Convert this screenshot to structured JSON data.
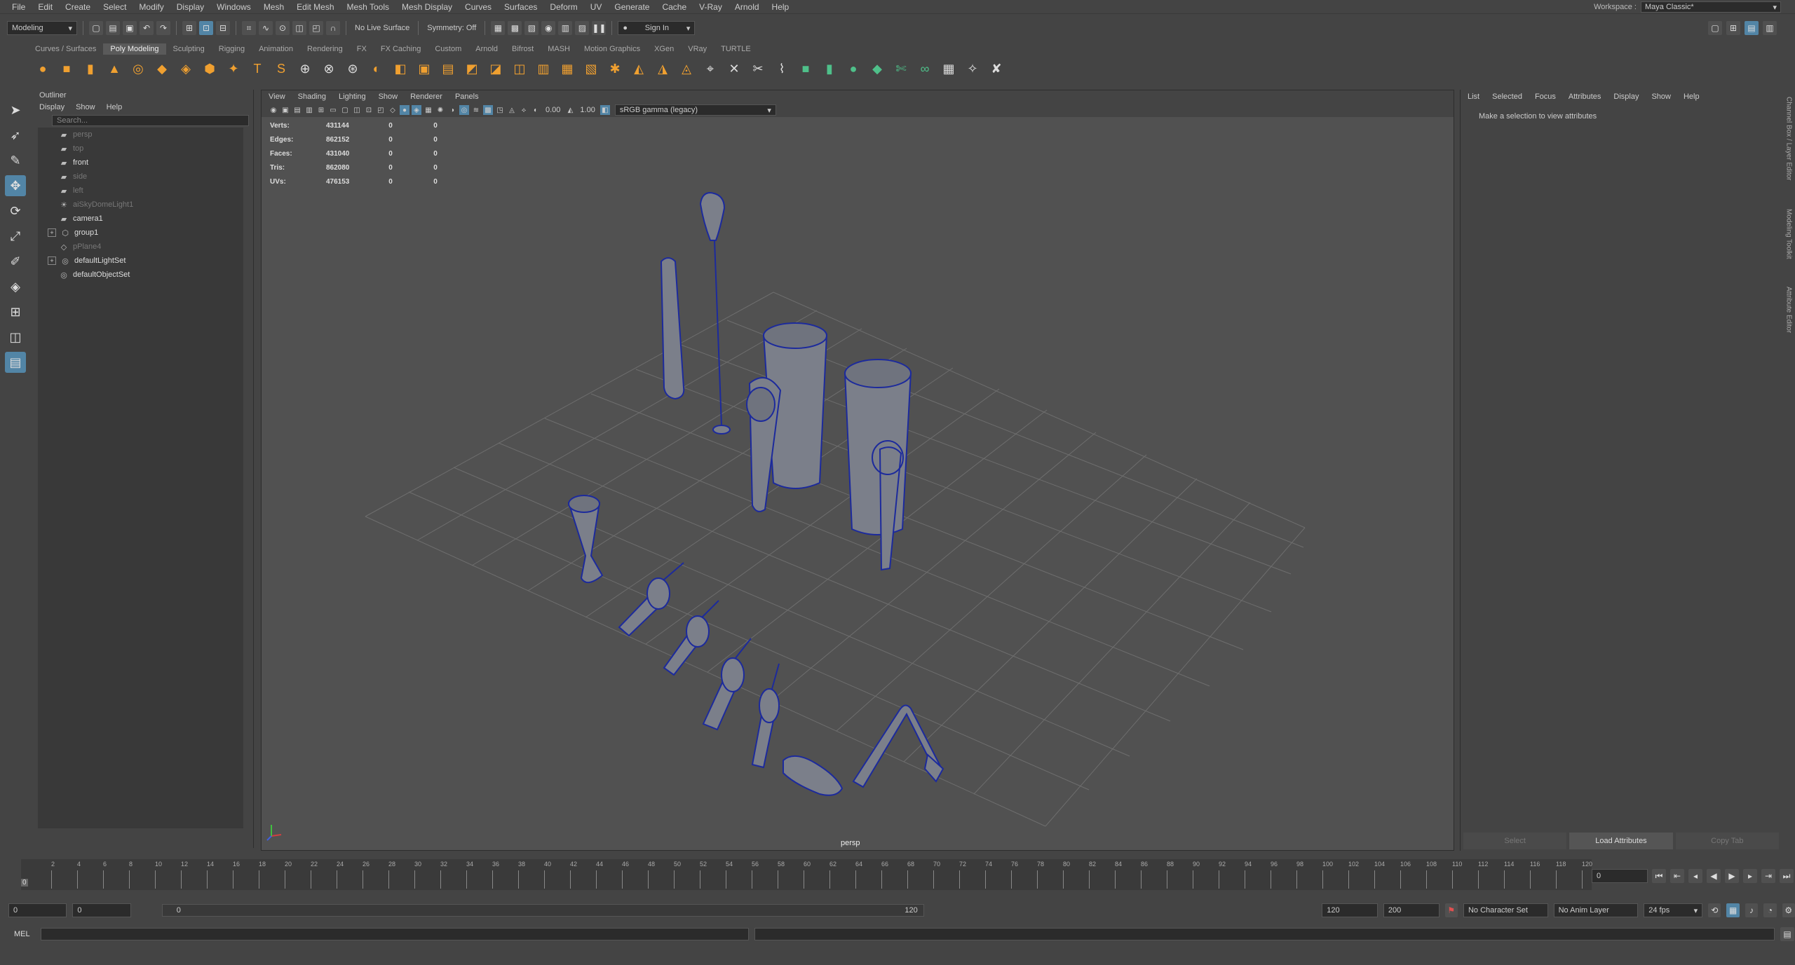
{
  "menubar": [
    "File",
    "Edit",
    "Create",
    "Select",
    "Modify",
    "Display",
    "Windows",
    "Mesh",
    "Edit Mesh",
    "Mesh Tools",
    "Mesh Display",
    "Curves",
    "Surfaces",
    "Deform",
    "UV",
    "Generate",
    "Cache",
    "V-Ray",
    "Arnold",
    "Help"
  ],
  "workspace": {
    "label": "Workspace :",
    "value": "Maya Classic*"
  },
  "statusline": {
    "mode": "Modeling",
    "live_surface": "No Live Surface",
    "symmetry": "Symmetry: Off",
    "sign_in": "Sign In"
  },
  "shelf_tabs": [
    "Curves / Surfaces",
    "Poly Modeling",
    "Sculpting",
    "Rigging",
    "Animation",
    "Rendering",
    "FX",
    "FX Caching",
    "Custom",
    "Arnold",
    "Bifrost",
    "MASH",
    "Motion Graphics",
    "XGen",
    "VRay",
    "TURTLE"
  ],
  "shelf_active": "Poly Modeling",
  "outliner": {
    "title": "Outliner",
    "menus": [
      "Display",
      "Show",
      "Help"
    ],
    "search_placeholder": "Search...",
    "items": [
      {
        "label": "persp",
        "dim": true,
        "icon": "camera-icon"
      },
      {
        "label": "top",
        "dim": true,
        "icon": "camera-icon"
      },
      {
        "label": "front",
        "dim": false,
        "icon": "camera-icon"
      },
      {
        "label": "side",
        "dim": true,
        "icon": "camera-icon"
      },
      {
        "label": "left",
        "dim": true,
        "icon": "camera-icon"
      },
      {
        "label": "aiSkyDomeLight1",
        "dim": true,
        "icon": "light-icon"
      },
      {
        "label": "camera1",
        "dim": false,
        "icon": "camera-icon"
      },
      {
        "label": "group1",
        "dim": false,
        "icon": "group-icon",
        "expand": true
      },
      {
        "label": "pPlane4",
        "dim": true,
        "icon": "mesh-icon"
      },
      {
        "label": "defaultLightSet",
        "dim": false,
        "icon": "set-icon",
        "expand": true
      },
      {
        "label": "defaultObjectSet",
        "dim": false,
        "icon": "set-icon"
      }
    ]
  },
  "viewport": {
    "menus": [
      "View",
      "Shading",
      "Lighting",
      "Show",
      "Renderer",
      "Panels"
    ],
    "exposure": "0.00",
    "gamma": "1.00",
    "colorspace": "sRGB gamma (legacy)",
    "camera": "persp",
    "hud": [
      {
        "key": "Verts:",
        "v": "431144",
        "a": "0",
        "b": "0"
      },
      {
        "key": "Edges:",
        "v": "862152",
        "a": "0",
        "b": "0"
      },
      {
        "key": "Faces:",
        "v": "431040",
        "a": "0",
        "b": "0"
      },
      {
        "key": "Tris:",
        "v": "862080",
        "a": "0",
        "b": "0"
      },
      {
        "key": "UVs:",
        "v": "476153",
        "a": "0",
        "b": "0"
      }
    ]
  },
  "attribute_editor": {
    "menus": [
      "List",
      "Selected",
      "Focus",
      "Attributes",
      "Display",
      "Show",
      "Help"
    ],
    "message": "Make a selection to view attributes",
    "buttons": [
      "Select",
      "Load Attributes",
      "Copy Tab"
    ]
  },
  "side_tabs": [
    "Channel Box / Layer Editor",
    "Modeling Toolkit",
    "Attribute Editor"
  ],
  "timeslider": {
    "labels": [
      "2",
      "4",
      "6",
      "8",
      "10",
      "12",
      "14",
      "16",
      "18",
      "20",
      "22",
      "24",
      "26",
      "28",
      "30",
      "32",
      "34",
      "36",
      "38",
      "40",
      "42",
      "44",
      "46",
      "48",
      "50",
      "52",
      "54",
      "56",
      "58",
      "60",
      "62",
      "64",
      "66",
      "68",
      "70",
      "72",
      "74",
      "76",
      "78",
      "80",
      "82",
      "84",
      "86",
      "88",
      "90",
      "92",
      "94",
      "96",
      "98",
      "100",
      "102",
      "104",
      "106",
      "108",
      "110",
      "112",
      "114",
      "116",
      "118",
      "120"
    ],
    "current_frame": "0",
    "current_marker": "0"
  },
  "range": {
    "start": "0",
    "start2": "0",
    "bar_start": "0",
    "bar_end": "120",
    "end": "120",
    "end2": "200",
    "character_set": "No Character Set",
    "anim_layer": "No Anim Layer",
    "fps": "24 fps"
  },
  "cmdline": {
    "label": "MEL"
  }
}
